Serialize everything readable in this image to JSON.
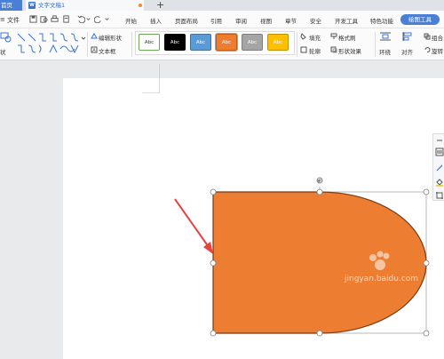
{
  "tabs": {
    "home": "首页",
    "document": "文字文稿1",
    "new_tab": "+"
  },
  "menubar": {
    "menu_icon": "≡",
    "file": "文件",
    "items": [
      "开始",
      "插入",
      "页面布局",
      "引用",
      "审阅",
      "视图",
      "章节",
      "安全",
      "开发工具",
      "特色功能"
    ],
    "active": "绘图工具"
  },
  "ribbon": {
    "shape_label_partial": "状",
    "edit_shape": "编辑形状",
    "text_box": "文本框",
    "styles": [
      {
        "label": "Abc",
        "bg": "#ffffff",
        "fg": "#333333",
        "border": "#6aa84f"
      },
      {
        "label": "Abc",
        "bg": "#000000",
        "fg": "#ffffff",
        "border": "#000000"
      },
      {
        "label": "Abc",
        "bg": "#5b9bd5",
        "fg": "#ffffff",
        "border": "#41719c"
      },
      {
        "label": "Abc",
        "bg": "#ed7d31",
        "fg": "#ffffff",
        "border": "#c55a11"
      },
      {
        "label": "Abc",
        "bg": "#a5a5a5",
        "fg": "#ffffff",
        "border": "#7f7f7f"
      },
      {
        "label": "Abc",
        "bg": "#ffc000",
        "fg": "#ffffff",
        "border": "#bf9000"
      }
    ],
    "fill": "填充",
    "outline": "轮廓",
    "format_brush": "格式刷",
    "shape_effects": "形状效果",
    "wrap": "环绕",
    "align": "对齐",
    "rotate_partial": "旋转",
    "combine_partial": "组合"
  },
  "canvas": {
    "shape_fill": "#ed7d31",
    "shape_outline": "#7a3b10",
    "arrow_color": "#e8423c"
  },
  "watermark": {
    "text": "jingyan.baidu.com"
  }
}
